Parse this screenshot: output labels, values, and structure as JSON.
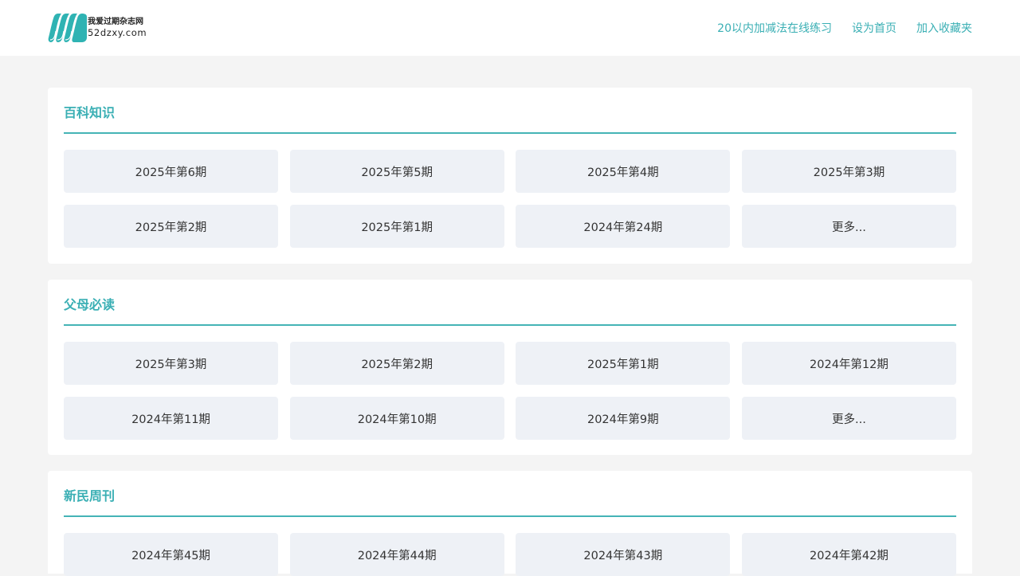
{
  "header": {
    "logo": {
      "name_cn": "我爱过期杂志网",
      "domain": "52dzxy.com"
    },
    "nav": [
      {
        "label": "20以内加减法在线练习"
      },
      {
        "label": "设为首页"
      },
      {
        "label": "加入收藏夹"
      }
    ]
  },
  "colors": {
    "accent": "#3aafb4",
    "tile_bg": "#eef1f6",
    "page_bg": "#f4f4f4"
  },
  "sections": [
    {
      "title": "百科知识",
      "items": [
        "2025年第6期",
        "2025年第5期",
        "2025年第4期",
        "2025年第3期",
        "2025年第2期",
        "2025年第1期",
        "2024年第24期",
        "更多..."
      ]
    },
    {
      "title": "父母必读",
      "items": [
        "2025年第3期",
        "2025年第2期",
        "2025年第1期",
        "2024年第12期",
        "2024年第11期",
        "2024年第10期",
        "2024年第9期",
        "更多..."
      ]
    },
    {
      "title": "新民周刊",
      "items": [
        "2024年第45期",
        "2024年第44期",
        "2024年第43期",
        "2024年第42期"
      ]
    }
  ]
}
